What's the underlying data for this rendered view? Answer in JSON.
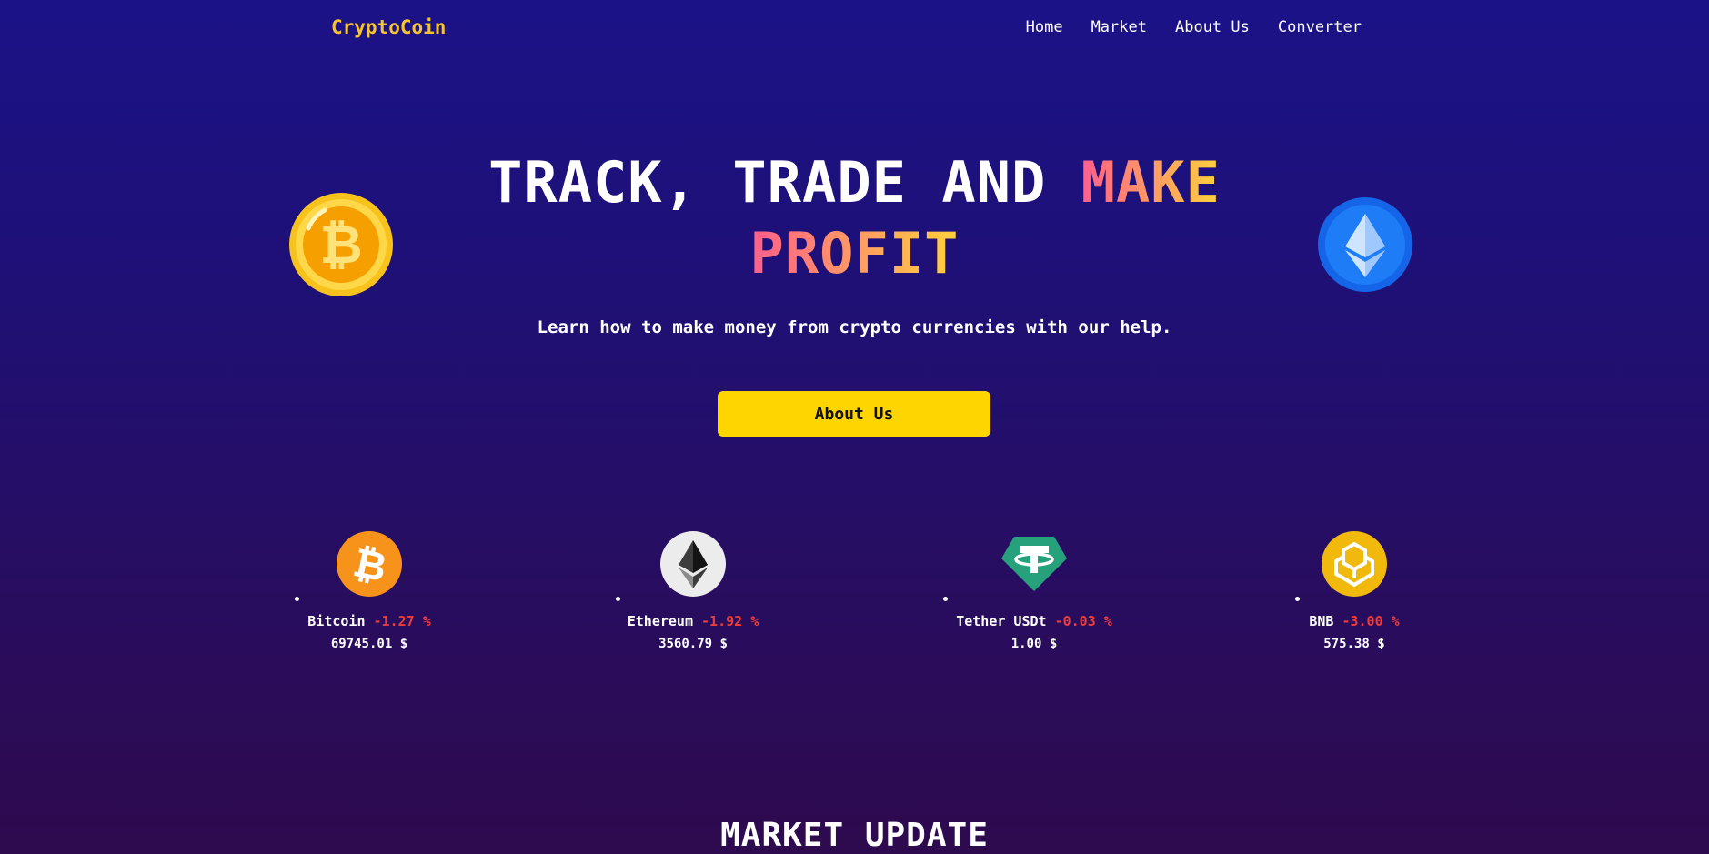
{
  "nav": {
    "brand": "CryptoCoin",
    "links": [
      "Home",
      "Market",
      "About Us",
      "Converter"
    ]
  },
  "hero": {
    "title_plain": "TRACK, TRADE AND ",
    "title_highlight_1": "MAKE",
    "title_highlight_2": "PROFIT",
    "subtitle": "Learn how to make money from crypto currencies with our help.",
    "cta_label": "About Us",
    "left_coin_icon": "bitcoin-gold-coin-icon",
    "right_coin_icon": "ethereum-blue-coin-icon"
  },
  "coins": [
    {
      "name": "Bitcoin",
      "change": "-1.27 %",
      "price": "69745.01 $",
      "icon": "bitcoin-icon"
    },
    {
      "name": "Ethereum",
      "change": "-1.92 %",
      "price": "3560.79 $",
      "icon": "ethereum-icon"
    },
    {
      "name": "Tether USDt",
      "change": "-0.03 %",
      "price": "1.00 $",
      "icon": "tether-icon"
    },
    {
      "name": "BNB",
      "change": "-3.00 %",
      "price": "575.38 $",
      "icon": "bnb-icon"
    }
  ],
  "market": {
    "title": "MARKET UPDATE"
  },
  "colors": {
    "brand": "#f5c430",
    "accent_button": "#ffd500",
    "negative": "#ef3b3b",
    "background_top": "#1b1287",
    "background_bottom": "#2e0a4e"
  }
}
